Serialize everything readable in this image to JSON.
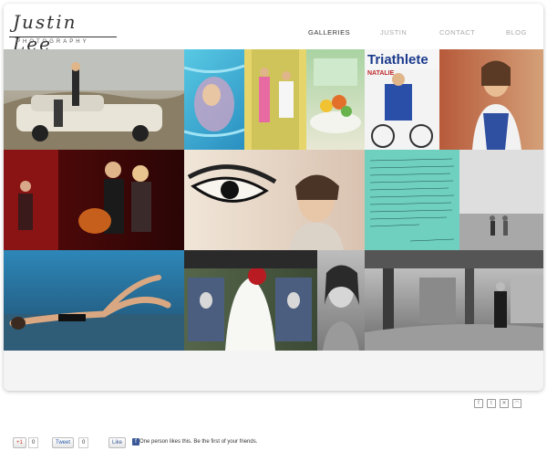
{
  "brand": {
    "script": "Justin Lee",
    "sub": "PHOTOGRAPHY"
  },
  "nav": {
    "items": [
      "GALLERIES",
      "JUSTIN",
      "CONTACT",
      "BLOG"
    ],
    "active": "GALLERIES"
  },
  "gallery": {
    "tiles": [
      {
        "name": "vintage-car-couple-photo",
        "color": "#b9b0a0"
      },
      {
        "name": "pool-swimmer-photo",
        "color": "#3fb6d6"
      },
      {
        "name": "wedding-couple-door-photo",
        "color": "#e8d86a"
      },
      {
        "name": "floral-table-photo",
        "color": "#79b07a"
      },
      {
        "name": "triathlete-magazine-cover",
        "color": "#d43c2c"
      },
      {
        "name": "woman-portrait-brick-photo",
        "color": "#b8623e"
      },
      {
        "name": "couple-guitar-stage-photo",
        "color": "#7a1212"
      },
      {
        "name": "eye-mural-bride-photo",
        "color": "#d9cbb8"
      },
      {
        "name": "handwritten-note-photo",
        "color": "#5ac3b4"
      },
      {
        "name": "couple-white-wall-photo",
        "color": "#cfcfcf"
      },
      {
        "name": "woman-lying-car-photo",
        "color": "#2c6d9a"
      },
      {
        "name": "kilt-wedding-photo",
        "color": "#4d5a3e"
      },
      {
        "name": "woman-portrait-bw-photo",
        "color": "#9a9a9a"
      },
      {
        "name": "man-courtyard-bw-photo",
        "color": "#7c7c7c"
      }
    ],
    "handwritten_note": "Well, you did it again... I've had so many compliments on your beautiful pictures..."
  },
  "footer": {
    "social_icons": [
      "facebook-icon",
      "twitter-icon",
      "flickr-icon",
      "rss-icon"
    ],
    "gplus_label": "+1",
    "gplus_count": "0",
    "tweet_label": "Tweet",
    "tweet_count": "0",
    "like_label": "Like",
    "like_text": "One person likes this. Be the first of your friends."
  }
}
